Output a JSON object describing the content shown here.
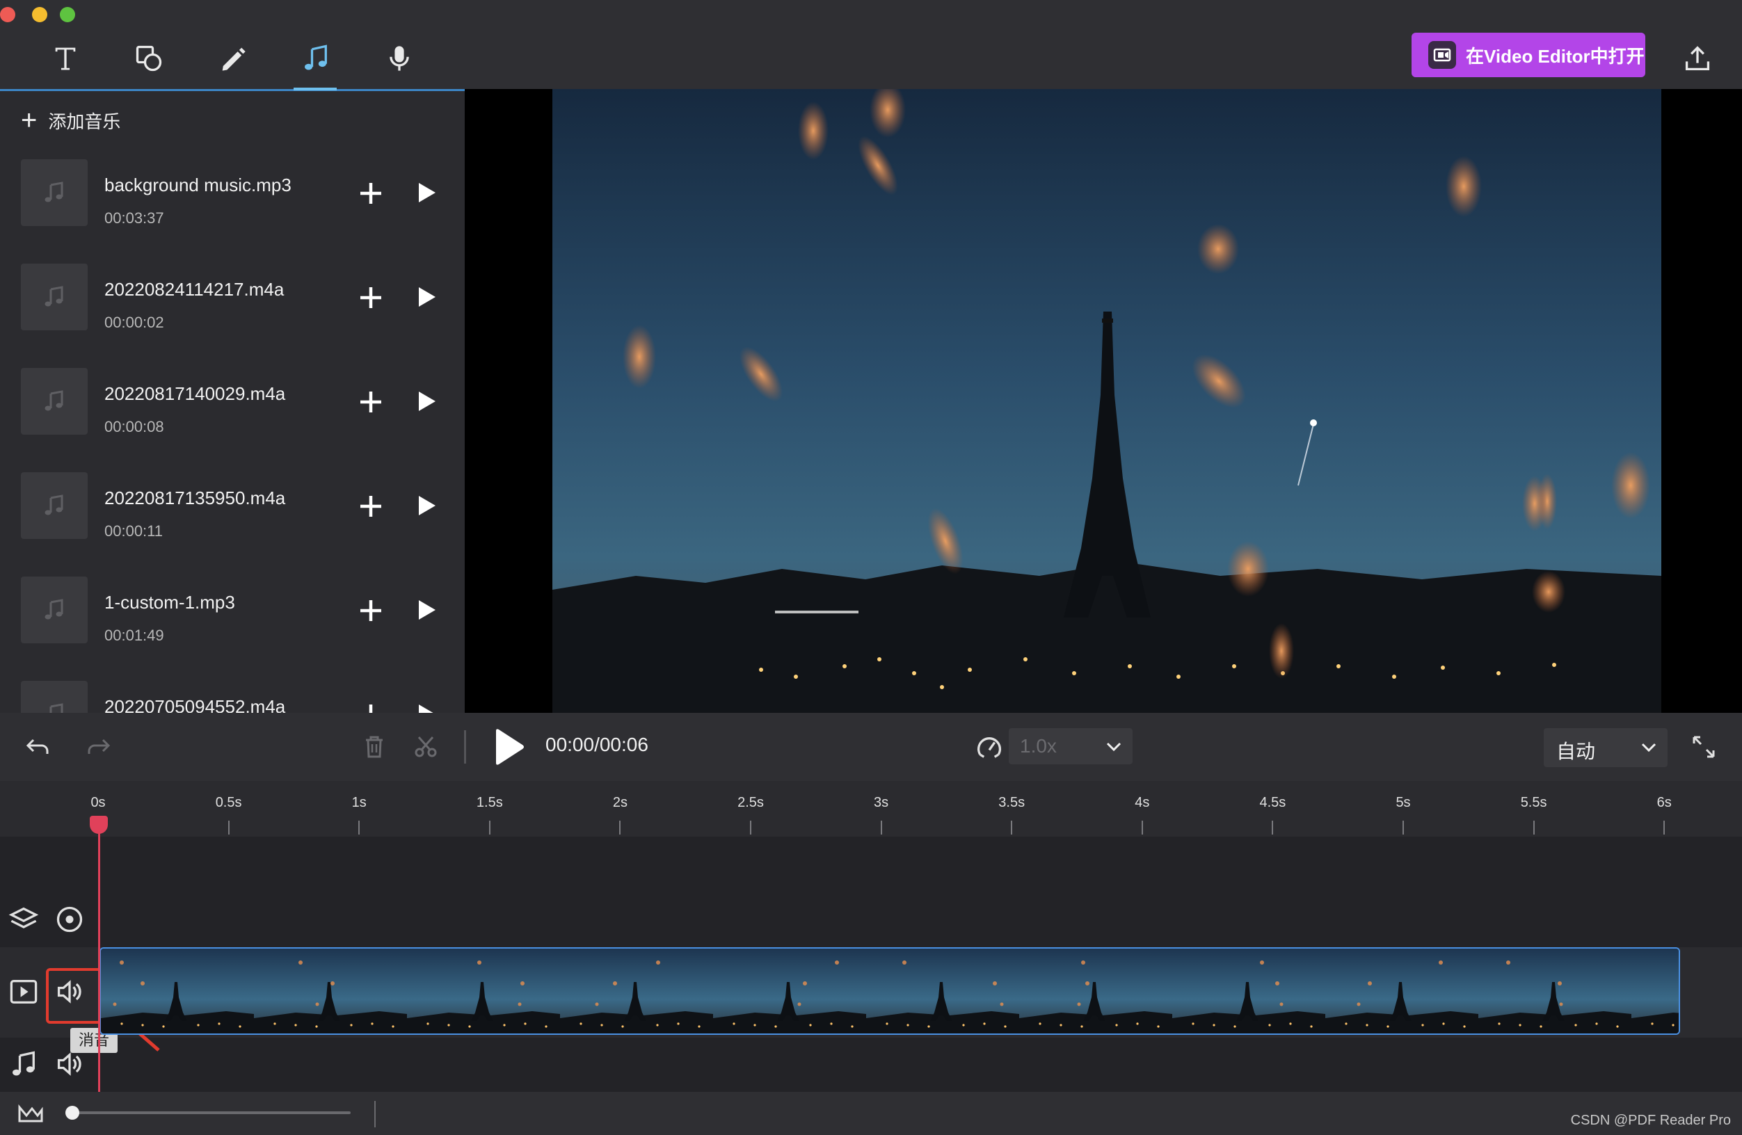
{
  "window": {
    "traffic_colors": [
      "#ee5b55",
      "#f5bd2f",
      "#5ec340"
    ]
  },
  "toolbar": {
    "tools": [
      "text-icon",
      "shapes-icon",
      "pen-icon",
      "music-icon",
      "microphone-icon"
    ],
    "active_tool": "music-icon",
    "open_editor_label": "在Video Editor中打开",
    "accent": "#b345e8"
  },
  "sidebar": {
    "add_music_label": "添加音乐",
    "tracks": [
      {
        "name": "background music.mp3",
        "duration": "00:03:37"
      },
      {
        "name": "20220824114217.m4a",
        "duration": "00:00:02"
      },
      {
        "name": "20220817140029.m4a",
        "duration": "00:00:08"
      },
      {
        "name": "20220817135950.m4a",
        "duration": "00:00:11"
      },
      {
        "name": "1-custom-1.mp3",
        "duration": "00:01:49"
      },
      {
        "name": "20220705094552.m4a",
        "duration": ""
      }
    ]
  },
  "controls": {
    "time": "00:00/00:06",
    "speed": "1.0x",
    "fit": "自动"
  },
  "ruler": {
    "labels": [
      "0s",
      "0.5s",
      "1s",
      "1.5s",
      "2s",
      "2.5s",
      "3s",
      "3.5s",
      "4s",
      "4.5s",
      "5s",
      "5.5s",
      "6s"
    ]
  },
  "timeline": {
    "tooltip": "消音",
    "playhead_seconds": 0,
    "duration_seconds": 6
  },
  "footer": {
    "watermark": "CSDN @PDF Reader Pro"
  }
}
